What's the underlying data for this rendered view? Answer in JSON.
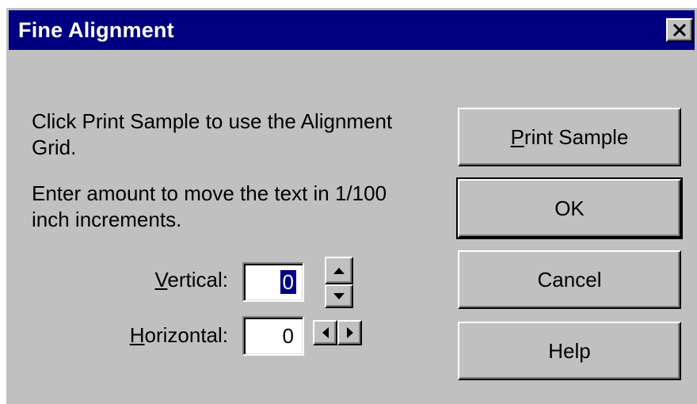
{
  "window": {
    "title": "Fine Alignment",
    "close_glyph": "✕"
  },
  "instructions": {
    "line1": "Click Print Sample to use the Alignment",
    "line2": "Grid.",
    "line3": "Enter amount to move the text in 1/100",
    "line4": "inch increments."
  },
  "vertical": {
    "label_ul": "V",
    "label_rest": "ertical:",
    "value": "0"
  },
  "horizontal": {
    "label_ul": "H",
    "label_rest": "orizontal:",
    "value": "0"
  },
  "buttons": {
    "print_ul": "P",
    "print_rest": "rint Sample",
    "ok": "OK",
    "cancel": "Cancel",
    "help": "Help"
  },
  "colors": {
    "titlebar": "#000080",
    "face": "#c0c0c0",
    "selection": "#000080"
  }
}
